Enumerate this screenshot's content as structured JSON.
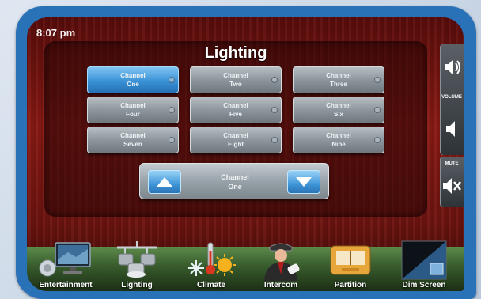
{
  "status": {
    "time": "8:07 pm"
  },
  "lighting": {
    "title": "Lighting",
    "channels": [
      {
        "line1": "Channel",
        "line2": "One",
        "active": true
      },
      {
        "line1": "Channel",
        "line2": "Two",
        "active": false
      },
      {
        "line1": "Channel",
        "line2": "Three",
        "active": false
      },
      {
        "line1": "Channel",
        "line2": "Four",
        "active": false
      },
      {
        "line1": "Channel",
        "line2": "Five",
        "active": false
      },
      {
        "line1": "Channel",
        "line2": "Six",
        "active": false
      },
      {
        "line1": "Channel",
        "line2": "Seven",
        "active": false
      },
      {
        "line1": "Channel",
        "line2": "Eight",
        "active": false
      },
      {
        "line1": "Channel",
        "line2": "Nine",
        "active": false
      }
    ],
    "selector": {
      "line1": "Channel",
      "line2": "One"
    }
  },
  "side": {
    "volume_label": "VOLUME",
    "mute_label": "MUTE"
  },
  "dock": [
    {
      "label": "Entertainment",
      "icon": "entertainment-icon"
    },
    {
      "label": "Lighting",
      "icon": "lighting-icon"
    },
    {
      "label": "Climate",
      "icon": "climate-icon"
    },
    {
      "label": "Intercom",
      "icon": "intercom-icon"
    },
    {
      "label": "Partition",
      "icon": "partition-icon"
    },
    {
      "label": "Dim Screen",
      "icon": "dim-screen-icon"
    }
  ],
  "colors": {
    "bezel": "#2a72b8",
    "active_button": "#3a92d6",
    "button": "#8d969c"
  }
}
